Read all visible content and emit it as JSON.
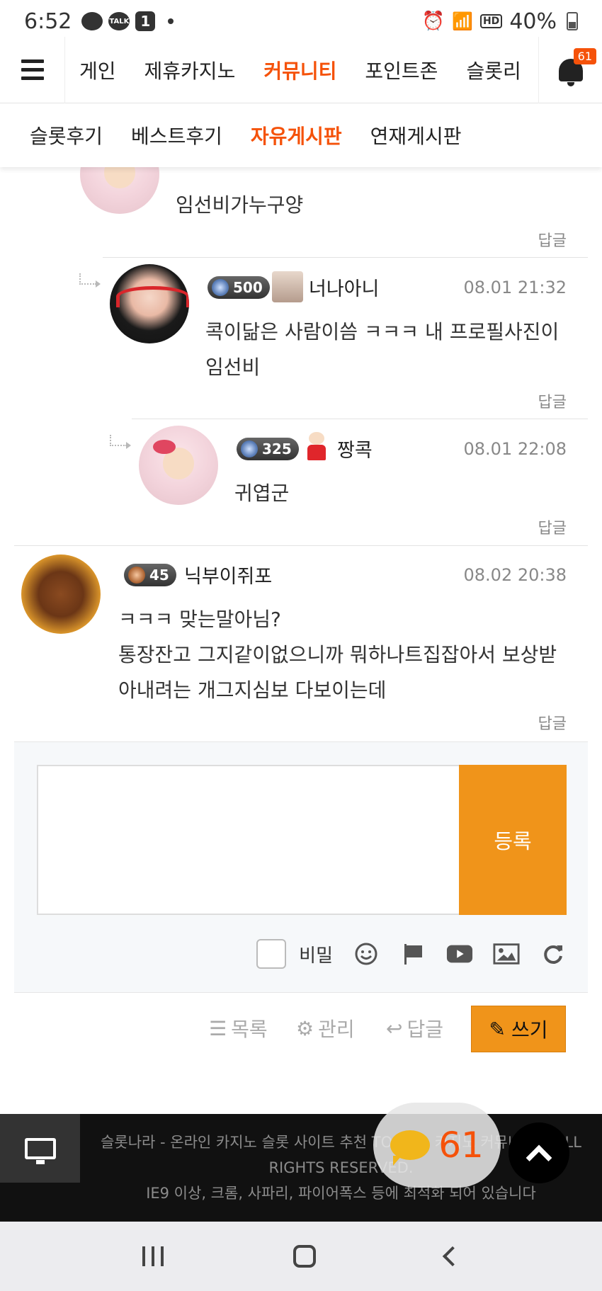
{
  "status_bar": {
    "time": "6:52",
    "battery": "40%",
    "talk_label": "TALK",
    "notif_count": "1",
    "hd_label": "HD"
  },
  "main_nav": {
    "items": [
      "게인",
      "제휴카지노",
      "커뮤니티",
      "포인트존",
      "슬롯리"
    ],
    "active_index": 2,
    "bell_badge": "61"
  },
  "sub_nav": {
    "items": [
      "슬롯후기",
      "베스트후기",
      "자유게시판",
      "연재게시판"
    ],
    "active_index": 2
  },
  "comments": [
    {
      "content": "임선비가누구양",
      "reply_label": "답글"
    },
    {
      "level": "500",
      "name": "너나아니",
      "date": "08.01 21:32",
      "content_lines": [
        "콕이닮은 사람이씀 ㅋㅋㅋ 내 프로필사진이",
        "임선비"
      ],
      "reply_label": "답글"
    },
    {
      "level": "325",
      "name": "짱콕",
      "date": "08.01 22:08",
      "content": "귀엽군",
      "reply_label": "답글"
    },
    {
      "level": "45",
      "name": "닉부이쥐포",
      "date": "08.02 20:38",
      "content_lines": [
        "ㅋㅋㅋ 맞는말아님?",
        "통장잔고 그지같이없으니까 뭐하나트집잡아서 보상받",
        "아내려는 개그지심보 다보이는데"
      ],
      "reply_label": "답글"
    }
  ],
  "write_box": {
    "submit_label": "등록",
    "secret_label": "비밀",
    "tools": [
      "smile-icon",
      "flag-icon",
      "youtube-icon",
      "image-icon",
      "refresh-icon"
    ]
  },
  "actions": {
    "list_label": "목록",
    "manage_label": "관리",
    "reply_label": "답글",
    "write_label": "쓰기"
  },
  "footer": {
    "line1": "슬롯나라 - 온라인 카지노 슬롯 사이트 추천 TOP 15, 카지노 커뮤니티 ©ALL RIGHTS RESERVED.",
    "line2": "IE9 이상, 크롬, 사파리, 파이어폭스 등에 최적화 되어 있습니다",
    "chat_count": "61"
  },
  "colors": {
    "accent": "#f5520a",
    "button": "#f0941a"
  }
}
